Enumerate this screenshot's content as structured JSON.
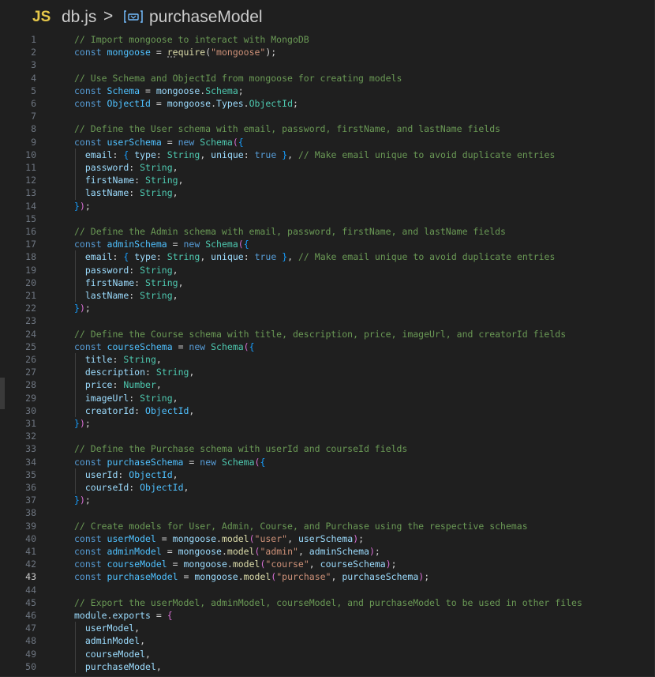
{
  "breadcrumb": {
    "language_badge": "JS",
    "file_name": "db.js",
    "separator": ">",
    "symbol_icon": "symbol-variable-icon",
    "symbol_name": "purchaseModel"
  },
  "editor": {
    "active_line": 43,
    "lines": [
      {
        "n": "1",
        "tokens": [
          [
            "c",
            "// Import mongoose to interact with MongoDB"
          ]
        ]
      },
      {
        "n": "2",
        "tokens": [
          [
            "k",
            "const "
          ],
          [
            "const",
            "mongoose"
          ],
          [
            "p",
            " = "
          ],
          [
            "f",
            "require"
          ],
          [
            "p",
            "("
          ],
          [
            "s",
            "\"mongoose\""
          ],
          [
            "p",
            ");"
          ]
        ]
      },
      {
        "n": "3",
        "tokens": []
      },
      {
        "n": "4",
        "tokens": [
          [
            "c",
            "// Use Schema and ObjectId from mongoose for creating models"
          ]
        ]
      },
      {
        "n": "5",
        "tokens": [
          [
            "k",
            "const "
          ],
          [
            "const",
            "Schema"
          ],
          [
            "p",
            " = "
          ],
          [
            "v",
            "mongoose"
          ],
          [
            "p",
            "."
          ],
          [
            "t",
            "Schema"
          ],
          [
            "p",
            ";"
          ]
        ]
      },
      {
        "n": "6",
        "tokens": [
          [
            "k",
            "const "
          ],
          [
            "const",
            "ObjectId"
          ],
          [
            "p",
            " = "
          ],
          [
            "v",
            "mongoose"
          ],
          [
            "p",
            "."
          ],
          [
            "v",
            "Types"
          ],
          [
            "p",
            "."
          ],
          [
            "t",
            "ObjectId"
          ],
          [
            "p",
            ";"
          ]
        ]
      },
      {
        "n": "7",
        "tokens": []
      },
      {
        "n": "8",
        "tokens": [
          [
            "c",
            "// Define the User schema with email, password, firstName, and lastName fields"
          ]
        ]
      },
      {
        "n": "9",
        "tokens": [
          [
            "k",
            "const "
          ],
          [
            "const",
            "userSchema"
          ],
          [
            "p",
            " = "
          ],
          [
            "k",
            "new "
          ],
          [
            "t",
            "Schema"
          ],
          [
            "b",
            "("
          ],
          [
            "b2",
            "{"
          ]
        ]
      },
      {
        "n": "10",
        "tokens": [
          [
            "p",
            "  "
          ],
          [
            "v",
            "email"
          ],
          [
            "p",
            ": "
          ],
          [
            "br",
            "{ "
          ],
          [
            "v",
            "type"
          ],
          [
            "p",
            ": "
          ],
          [
            "t",
            "String"
          ],
          [
            "p",
            ", "
          ],
          [
            "v",
            "unique"
          ],
          [
            "p",
            ": "
          ],
          [
            "k",
            "true"
          ],
          [
            "br",
            " }"
          ],
          [
            "p",
            ", "
          ],
          [
            "c",
            "// Make email unique to avoid duplicate entries"
          ]
        ]
      },
      {
        "n": "11",
        "tokens": [
          [
            "p",
            "  "
          ],
          [
            "v",
            "password"
          ],
          [
            "p",
            ": "
          ],
          [
            "t",
            "String"
          ],
          [
            "p",
            ","
          ]
        ]
      },
      {
        "n": "12",
        "tokens": [
          [
            "p",
            "  "
          ],
          [
            "v",
            "firstName"
          ],
          [
            "p",
            ": "
          ],
          [
            "t",
            "String"
          ],
          [
            "p",
            ","
          ]
        ]
      },
      {
        "n": "13",
        "tokens": [
          [
            "p",
            "  "
          ],
          [
            "v",
            "lastName"
          ],
          [
            "p",
            ": "
          ],
          [
            "t",
            "String"
          ],
          [
            "p",
            ","
          ]
        ]
      },
      {
        "n": "14",
        "tokens": [
          [
            "b2",
            "}"
          ],
          [
            "b",
            ")"
          ],
          [
            "p",
            ";"
          ]
        ]
      },
      {
        "n": "15",
        "tokens": []
      },
      {
        "n": "16",
        "tokens": [
          [
            "c",
            "// Define the Admin schema with email, password, firstName, and lastName fields"
          ]
        ]
      },
      {
        "n": "17",
        "tokens": [
          [
            "k",
            "const "
          ],
          [
            "const",
            "adminSchema"
          ],
          [
            "p",
            " = "
          ],
          [
            "k",
            "new "
          ],
          [
            "t",
            "Schema"
          ],
          [
            "b",
            "("
          ],
          [
            "b2",
            "{"
          ]
        ]
      },
      {
        "n": "18",
        "tokens": [
          [
            "p",
            "  "
          ],
          [
            "v",
            "email"
          ],
          [
            "p",
            ": "
          ],
          [
            "br",
            "{ "
          ],
          [
            "v",
            "type"
          ],
          [
            "p",
            ": "
          ],
          [
            "t",
            "String"
          ],
          [
            "p",
            ", "
          ],
          [
            "v",
            "unique"
          ],
          [
            "p",
            ": "
          ],
          [
            "k",
            "true"
          ],
          [
            "br",
            " }"
          ],
          [
            "p",
            ", "
          ],
          [
            "c",
            "// Make email unique to avoid duplicate entries"
          ]
        ]
      },
      {
        "n": "19",
        "tokens": [
          [
            "p",
            "  "
          ],
          [
            "v",
            "password"
          ],
          [
            "p",
            ": "
          ],
          [
            "t",
            "String"
          ],
          [
            "p",
            ","
          ]
        ]
      },
      {
        "n": "20",
        "tokens": [
          [
            "p",
            "  "
          ],
          [
            "v",
            "firstName"
          ],
          [
            "p",
            ": "
          ],
          [
            "t",
            "String"
          ],
          [
            "p",
            ","
          ]
        ]
      },
      {
        "n": "21",
        "tokens": [
          [
            "p",
            "  "
          ],
          [
            "v",
            "lastName"
          ],
          [
            "p",
            ": "
          ],
          [
            "t",
            "String"
          ],
          [
            "p",
            ","
          ]
        ]
      },
      {
        "n": "22",
        "tokens": [
          [
            "b2",
            "}"
          ],
          [
            "b",
            ")"
          ],
          [
            "p",
            ";"
          ]
        ]
      },
      {
        "n": "23",
        "tokens": []
      },
      {
        "n": "24",
        "tokens": [
          [
            "c",
            "// Define the Course schema with title, description, price, imageUrl, and creatorId fields"
          ]
        ]
      },
      {
        "n": "25",
        "tokens": [
          [
            "k",
            "const "
          ],
          [
            "const",
            "courseSchema"
          ],
          [
            "p",
            " = "
          ],
          [
            "k",
            "new "
          ],
          [
            "t",
            "Schema"
          ],
          [
            "b",
            "("
          ],
          [
            "b2",
            "{"
          ]
        ]
      },
      {
        "n": "26",
        "tokens": [
          [
            "p",
            "  "
          ],
          [
            "v",
            "title"
          ],
          [
            "p",
            ": "
          ],
          [
            "t",
            "String"
          ],
          [
            "p",
            ","
          ]
        ]
      },
      {
        "n": "27",
        "tokens": [
          [
            "p",
            "  "
          ],
          [
            "v",
            "description"
          ],
          [
            "p",
            ": "
          ],
          [
            "t",
            "String"
          ],
          [
            "p",
            ","
          ]
        ]
      },
      {
        "n": "28",
        "tokens": [
          [
            "p",
            "  "
          ],
          [
            "v",
            "price"
          ],
          [
            "p",
            ": "
          ],
          [
            "t",
            "Number"
          ],
          [
            "p",
            ","
          ]
        ]
      },
      {
        "n": "29",
        "tokens": [
          [
            "p",
            "  "
          ],
          [
            "v",
            "imageUrl"
          ],
          [
            "p",
            ": "
          ],
          [
            "t",
            "String"
          ],
          [
            "p",
            ","
          ]
        ]
      },
      {
        "n": "30",
        "tokens": [
          [
            "p",
            "  "
          ],
          [
            "v",
            "creatorId"
          ],
          [
            "p",
            ": "
          ],
          [
            "const",
            "ObjectId"
          ],
          [
            "p",
            ","
          ]
        ]
      },
      {
        "n": "31",
        "tokens": [
          [
            "b2",
            "}"
          ],
          [
            "b",
            ")"
          ],
          [
            "p",
            ";"
          ]
        ]
      },
      {
        "n": "32",
        "tokens": []
      },
      {
        "n": "33",
        "tokens": [
          [
            "c",
            "// Define the Purchase schema with userId and courseId fields"
          ]
        ]
      },
      {
        "n": "34",
        "tokens": [
          [
            "k",
            "const "
          ],
          [
            "const",
            "purchaseSchema"
          ],
          [
            "p",
            " = "
          ],
          [
            "k",
            "new "
          ],
          [
            "t",
            "Schema"
          ],
          [
            "b",
            "("
          ],
          [
            "b2",
            "{"
          ]
        ]
      },
      {
        "n": "35",
        "tokens": [
          [
            "p",
            "  "
          ],
          [
            "v",
            "userId"
          ],
          [
            "p",
            ": "
          ],
          [
            "const",
            "ObjectId"
          ],
          [
            "p",
            ","
          ]
        ]
      },
      {
        "n": "36",
        "tokens": [
          [
            "p",
            "  "
          ],
          [
            "v",
            "courseId"
          ],
          [
            "p",
            ": "
          ],
          [
            "const",
            "ObjectId"
          ],
          [
            "p",
            ","
          ]
        ]
      },
      {
        "n": "37",
        "tokens": [
          [
            "b2",
            "}"
          ],
          [
            "b",
            ")"
          ],
          [
            "p",
            ";"
          ]
        ]
      },
      {
        "n": "38",
        "tokens": []
      },
      {
        "n": "39",
        "tokens": [
          [
            "c",
            "// Create models for User, Admin, Course, and Purchase using the respective schemas"
          ]
        ]
      },
      {
        "n": "40",
        "tokens": [
          [
            "k",
            "const "
          ],
          [
            "const",
            "userModel"
          ],
          [
            "p",
            " = "
          ],
          [
            "v",
            "mongoose"
          ],
          [
            "p",
            "."
          ],
          [
            "f",
            "model"
          ],
          [
            "b",
            "("
          ],
          [
            "s",
            "\"user\""
          ],
          [
            "p",
            ", "
          ],
          [
            "v",
            "userSchema"
          ],
          [
            "b",
            ")"
          ],
          [
            "p",
            ";"
          ]
        ]
      },
      {
        "n": "41",
        "tokens": [
          [
            "k",
            "const "
          ],
          [
            "const",
            "adminModel"
          ],
          [
            "p",
            " = "
          ],
          [
            "v",
            "mongoose"
          ],
          [
            "p",
            "."
          ],
          [
            "f",
            "model"
          ],
          [
            "b",
            "("
          ],
          [
            "s",
            "\"admin\""
          ],
          [
            "p",
            ", "
          ],
          [
            "v",
            "adminSchema"
          ],
          [
            "b",
            ")"
          ],
          [
            "p",
            ";"
          ]
        ]
      },
      {
        "n": "42",
        "tokens": [
          [
            "k",
            "const "
          ],
          [
            "const",
            "courseModel"
          ],
          [
            "p",
            " = "
          ],
          [
            "v",
            "mongoose"
          ],
          [
            "p",
            "."
          ],
          [
            "f",
            "model"
          ],
          [
            "b",
            "("
          ],
          [
            "s",
            "\"course\""
          ],
          [
            "p",
            ", "
          ],
          [
            "v",
            "courseSchema"
          ],
          [
            "b",
            ")"
          ],
          [
            "p",
            ";"
          ]
        ]
      },
      {
        "n": "43",
        "tokens": [
          [
            "k",
            "const "
          ],
          [
            "const",
            "purchaseModel"
          ],
          [
            "p",
            " = "
          ],
          [
            "v",
            "mongoose"
          ],
          [
            "p",
            "."
          ],
          [
            "f",
            "model"
          ],
          [
            "b",
            "("
          ],
          [
            "s",
            "\"purchase\""
          ],
          [
            "p",
            ", "
          ],
          [
            "v",
            "purchaseSchema"
          ],
          [
            "b",
            ")"
          ],
          [
            "p",
            ";"
          ]
        ]
      },
      {
        "n": "44",
        "tokens": []
      },
      {
        "n": "45",
        "tokens": [
          [
            "c",
            "// Export the userModel, adminModel, courseModel, and purchaseModel to be used in other files"
          ]
        ]
      },
      {
        "n": "46",
        "tokens": [
          [
            "v",
            "module"
          ],
          [
            "p",
            "."
          ],
          [
            "v",
            "exports"
          ],
          [
            "p",
            " = "
          ],
          [
            "b",
            "{"
          ]
        ]
      },
      {
        "n": "47",
        "tokens": [
          [
            "p",
            "  "
          ],
          [
            "v",
            "userModel"
          ],
          [
            "p",
            ","
          ]
        ]
      },
      {
        "n": "48",
        "tokens": [
          [
            "p",
            "  "
          ],
          [
            "v",
            "adminModel"
          ],
          [
            "p",
            ","
          ]
        ]
      },
      {
        "n": "49",
        "tokens": [
          [
            "p",
            "  "
          ],
          [
            "v",
            "courseModel"
          ],
          [
            "p",
            ","
          ]
        ]
      },
      {
        "n": "50",
        "tokens": [
          [
            "p",
            "  "
          ],
          [
            "v",
            "purchaseModel"
          ],
          [
            "p",
            ","
          ]
        ]
      }
    ]
  },
  "colors": {
    "background": "#1f1f1f",
    "comment": "#6a9955",
    "keyword": "#569cd6",
    "string": "#ce9178",
    "type": "#4ec9b0",
    "function": "#dcdcaa",
    "variable": "#9cdcfe",
    "constant": "#4fc1ff",
    "js_badge": "#e6c84a"
  }
}
